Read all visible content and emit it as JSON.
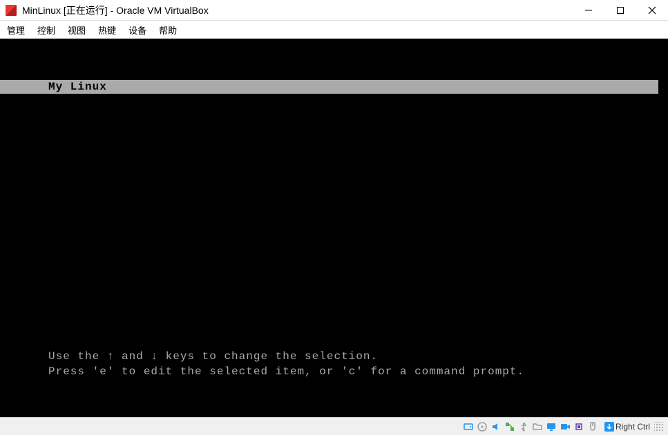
{
  "window": {
    "title": "MinLinux [正在运行] - Oracle VM VirtualBox"
  },
  "menu": {
    "items": [
      "管理",
      "控制",
      "视图",
      "热键",
      "设备",
      "帮助"
    ]
  },
  "boot": {
    "selected_entry": "My Linux",
    "hint_line1": "Use the ↑ and ↓ keys to change the selection.",
    "hint_line2": "Press 'e' to edit the selected item, or 'c' for a command prompt."
  },
  "statusbar": {
    "host_key": "Right Ctrl",
    "icons": [
      "hard-disk-icon",
      "optical-disk-icon",
      "audio-icon",
      "network-icon",
      "usb-icon",
      "shared-folder-icon",
      "display-icon",
      "recording-icon",
      "cpu-icon",
      "mouse-integration-icon"
    ]
  },
  "colors": {
    "boot_highlight_bg": "#aaaaaa",
    "boot_text": "#aaaaaa",
    "screen_bg": "#000000"
  }
}
